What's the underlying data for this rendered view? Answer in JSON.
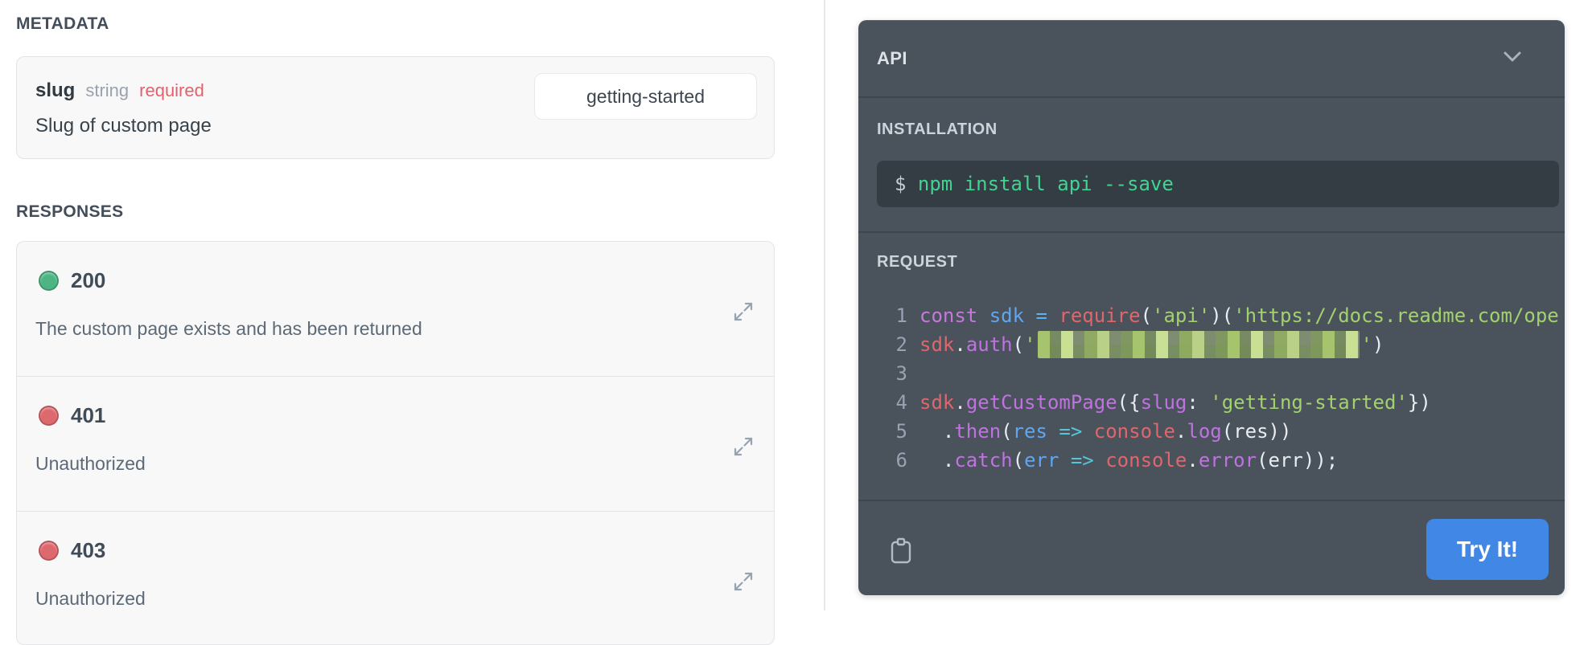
{
  "left": {
    "metadata_heading": "METADATA",
    "param": {
      "name": "slug",
      "type": "string",
      "required_label": "required",
      "description": "Slug of custom page",
      "value": "getting-started"
    },
    "responses_heading": "RESPONSES",
    "responses": [
      {
        "code": "200",
        "status": "success",
        "status_color": "#4db583",
        "description": "The custom page exists and has been returned"
      },
      {
        "code": "401",
        "status": "error",
        "status_color": "#dd686e",
        "description": "Unauthorized"
      },
      {
        "code": "403",
        "status": "error",
        "status_color": "#dd686e",
        "description": "Unauthorized"
      }
    ]
  },
  "panel": {
    "title": "API",
    "installation_heading": "INSTALLATION",
    "install_prompt": "$ ",
    "install_command": "npm install api --save",
    "request_heading": "REQUEST",
    "try_button_label": "Try It!",
    "code_lines": [
      {
        "num": "1",
        "segments": [
          [
            "kw",
            "const "
          ],
          [
            "var",
            "sdk "
          ],
          [
            "op",
            "= "
          ],
          [
            "obj",
            "require"
          ],
          [
            "pn",
            "("
          ],
          [
            "str",
            "'api'"
          ],
          [
            "pn",
            ")("
          ],
          [
            "str",
            "'https://docs.readme.com/ope"
          ]
        ]
      },
      {
        "num": "2",
        "segments": [
          [
            "obj",
            "sdk"
          ],
          [
            "pn",
            "."
          ],
          [
            "meth",
            "auth"
          ],
          [
            "pn",
            "("
          ],
          [
            "str",
            "'"
          ],
          [
            "redacted",
            ""
          ],
          [
            "str",
            "'"
          ],
          [
            "pn",
            ")"
          ]
        ]
      },
      {
        "num": "3",
        "segments": []
      },
      {
        "num": "4",
        "segments": [
          [
            "obj",
            "sdk"
          ],
          [
            "pn",
            "."
          ],
          [
            "meth",
            "getCustomPage"
          ],
          [
            "pn",
            "({"
          ],
          [
            "meth",
            "slug"
          ],
          [
            "pn",
            ": "
          ],
          [
            "str",
            "'getting-started'"
          ],
          [
            "pn",
            "})"
          ]
        ]
      },
      {
        "num": "5",
        "segments": [
          [
            "pn",
            "  ."
          ],
          [
            "meth",
            "then"
          ],
          [
            "pn",
            "("
          ],
          [
            "var",
            "res "
          ],
          [
            "arrow",
            "=> "
          ],
          [
            "obj",
            "console"
          ],
          [
            "pn",
            "."
          ],
          [
            "meth",
            "log"
          ],
          [
            "pn",
            "(res))"
          ]
        ]
      },
      {
        "num": "6",
        "segments": [
          [
            "pn",
            "  ."
          ],
          [
            "meth",
            "catch"
          ],
          [
            "pn",
            "("
          ],
          [
            "var",
            "err "
          ],
          [
            "arrow",
            "=> "
          ],
          [
            "obj",
            "console"
          ],
          [
            "pn",
            "."
          ],
          [
            "meth",
            "error"
          ],
          [
            "pn",
            "(err));"
          ]
        ]
      }
    ],
    "icons": {
      "header_icon": "chevron-down-icon",
      "footer_icon": "clipboard-icon",
      "response_row_icon": "expand-diagonal-icon"
    }
  },
  "colors": {
    "accent_blue": "#4187e5",
    "status_success": "#4db583",
    "status_error": "#dd686e",
    "panel_bg": "#4a535b",
    "code_block_bg": "#353d44",
    "install_command_green": "#42d392"
  }
}
